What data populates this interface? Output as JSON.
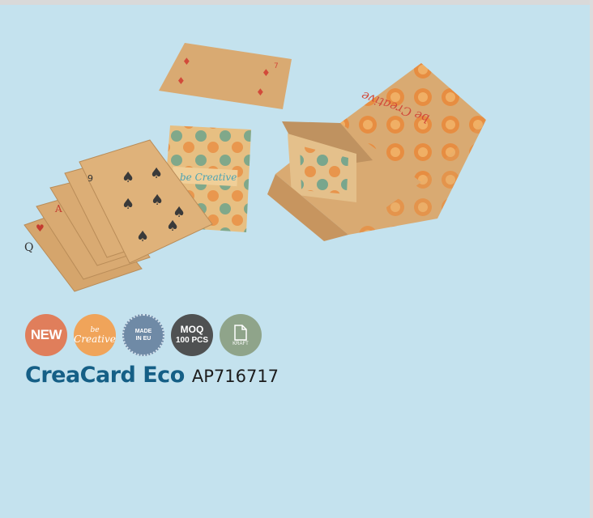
{
  "product": {
    "name": "CreaCard Eco",
    "code": "AP716717"
  },
  "photo": {
    "card_brand": "be Creative",
    "box_brand": "be Creative"
  },
  "badges": [
    {
      "icon": "new-badge",
      "label": "NEW",
      "color": "#e07e5b"
    },
    {
      "icon": "be-creative-badge",
      "line1": "be",
      "line2": "Creative",
      "color": "#f0a45a"
    },
    {
      "icon": "made-in-eu-badge",
      "line1": "MADE",
      "line2": "IN EU",
      "color": "#6f8aa6"
    },
    {
      "icon": "moq-badge",
      "line1": "MOQ",
      "line2": "100 PCS",
      "color": "#4f5152"
    },
    {
      "icon": "kraft-badge",
      "label": "KRAFT",
      "color": "#8fa48a"
    }
  ],
  "colors": {
    "background": "#c4e2ee",
    "title": "#155f86",
    "kraft_paper": "#d9aa72",
    "orange_print": "#e98a3c",
    "teal_print": "#5ea08d"
  }
}
